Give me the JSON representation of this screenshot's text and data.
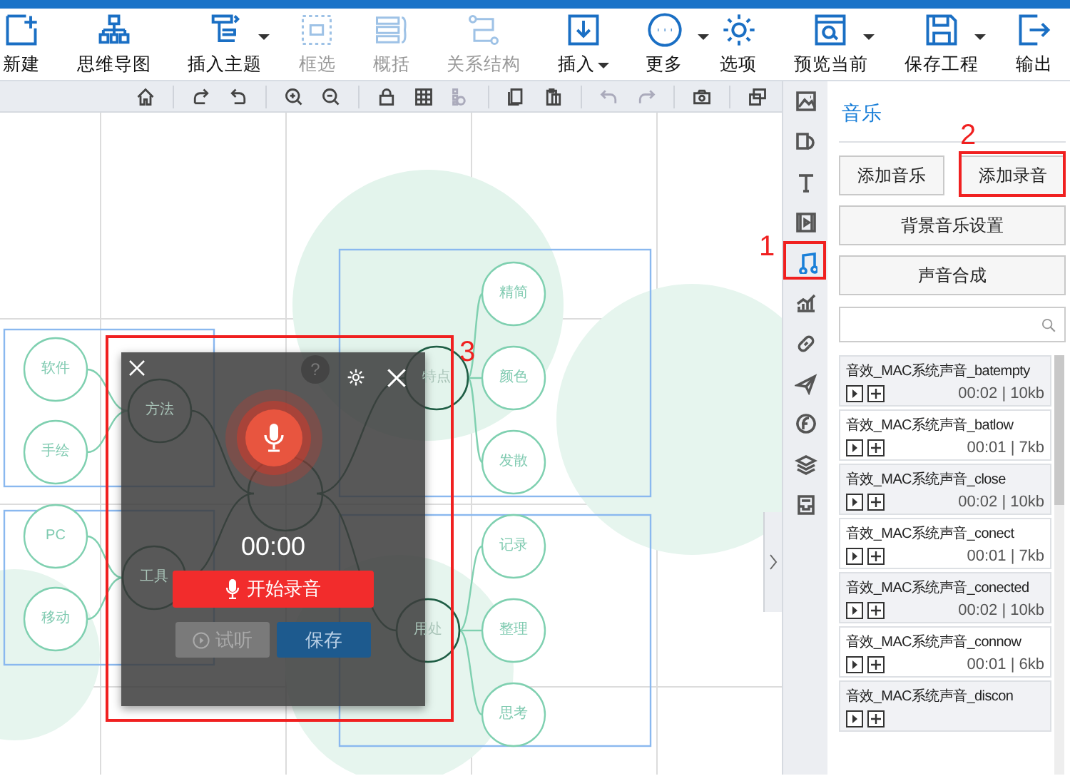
{
  "toolbar": [
    {
      "label": "新建",
      "kind": "new",
      "disabled": false,
      "dropdown": false
    },
    {
      "label": "思维导图",
      "kind": "mindmap",
      "disabled": false,
      "dropdown": false
    },
    {
      "label": "插入主题",
      "kind": "topic",
      "disabled": false,
      "dropdown": true
    },
    {
      "label": "框选",
      "kind": "select",
      "disabled": true,
      "dropdown": false
    },
    {
      "label": "概括",
      "kind": "summary",
      "disabled": true,
      "dropdown": false
    },
    {
      "label": "关系结构",
      "kind": "relation",
      "disabled": true,
      "dropdown": false
    },
    {
      "label": "插入",
      "kind": "insert",
      "disabled": false,
      "dropdown": true
    },
    {
      "label": "更多",
      "kind": "more",
      "disabled": false,
      "dropdown": true
    },
    {
      "label": "选项",
      "kind": "options",
      "disabled": false,
      "dropdown": false
    },
    {
      "label": "预览当前",
      "kind": "preview",
      "disabled": false,
      "dropdown": true
    },
    {
      "label": "保存工程",
      "kind": "save",
      "disabled": false,
      "dropdown": true
    },
    {
      "label": "输出",
      "kind": "export",
      "disabled": false,
      "dropdown": false
    }
  ],
  "quick_tools": [
    [
      {
        "kind": "home",
        "disabled": false
      }
    ],
    [
      {
        "kind": "rotate-right",
        "disabled": false
      },
      {
        "kind": "rotate-left",
        "disabled": false
      }
    ],
    [
      {
        "kind": "zoom-in",
        "disabled": false
      },
      {
        "kind": "zoom-out",
        "disabled": false
      }
    ],
    [
      {
        "kind": "lock",
        "disabled": false
      },
      {
        "kind": "grid",
        "disabled": false
      },
      {
        "kind": "layout",
        "disabled": true
      }
    ],
    [
      {
        "kind": "copy",
        "disabled": false
      },
      {
        "kind": "paste",
        "disabled": false
      }
    ],
    [
      {
        "kind": "undo",
        "disabled": true
      },
      {
        "kind": "redo",
        "disabled": true
      }
    ],
    [
      {
        "kind": "camera",
        "disabled": false
      }
    ],
    [
      {
        "kind": "windows",
        "disabled": false
      }
    ]
  ],
  "mindmap": {
    "children": [
      {
        "label": "方法",
        "children": [
          {
            "label": "软件"
          },
          {
            "label": "手绘"
          }
        ]
      },
      {
        "label": "工具",
        "children": [
          {
            "label": "PC"
          },
          {
            "label": "移动"
          }
        ]
      },
      {
        "label": "特点",
        "children": [
          {
            "label": "精简"
          },
          {
            "label": "颜色"
          },
          {
            "label": "发散"
          }
        ]
      },
      {
        "label": "用处",
        "children": [
          {
            "label": "记录"
          },
          {
            "label": "整理"
          },
          {
            "label": "思考"
          }
        ]
      }
    ]
  },
  "recorder": {
    "help": "?",
    "time": "00:00",
    "record_label": "开始录音",
    "listen_label": "试听",
    "listen_disabled": true,
    "save_label": "保存"
  },
  "side_icons": [
    {
      "kind": "image",
      "selected": false
    },
    {
      "kind": "shape",
      "selected": false
    },
    {
      "kind": "text",
      "selected": false
    },
    {
      "kind": "video",
      "selected": false
    },
    {
      "kind": "music",
      "selected": true
    },
    {
      "kind": "chart",
      "selected": false
    },
    {
      "kind": "link",
      "selected": false
    },
    {
      "kind": "plane",
      "selected": false
    },
    {
      "kind": "flash",
      "selected": false
    },
    {
      "kind": "layers",
      "selected": false
    },
    {
      "kind": "inbox",
      "selected": false
    }
  ],
  "panel": {
    "title": "音乐",
    "add_buttons": [
      "添加音乐",
      "添加录音"
    ],
    "wide_buttons": [
      "背景音乐设置",
      "声音合成"
    ],
    "sounds": [
      {
        "name": "音效_MAC系统声音_batempty",
        "meta": "00:02 | 10kb"
      },
      {
        "name": "音效_MAC系统声音_batlow",
        "meta": "00:01 | 7kb"
      },
      {
        "name": "音效_MAC系统声音_close",
        "meta": "00:02 | 10kb"
      },
      {
        "name": "音效_MAC系统声音_conect",
        "meta": "00:01 | 7kb"
      },
      {
        "name": "音效_MAC系统声音_conected",
        "meta": "00:02 | 10kb"
      },
      {
        "name": "音效_MAC系统声音_connow",
        "meta": "00:01 | 6kb"
      },
      {
        "name": "音效_MAC系统声音_discon"
      }
    ]
  },
  "annotations": [
    {
      "number": "1"
    },
    {
      "number": "2"
    },
    {
      "number": "3"
    }
  ]
}
